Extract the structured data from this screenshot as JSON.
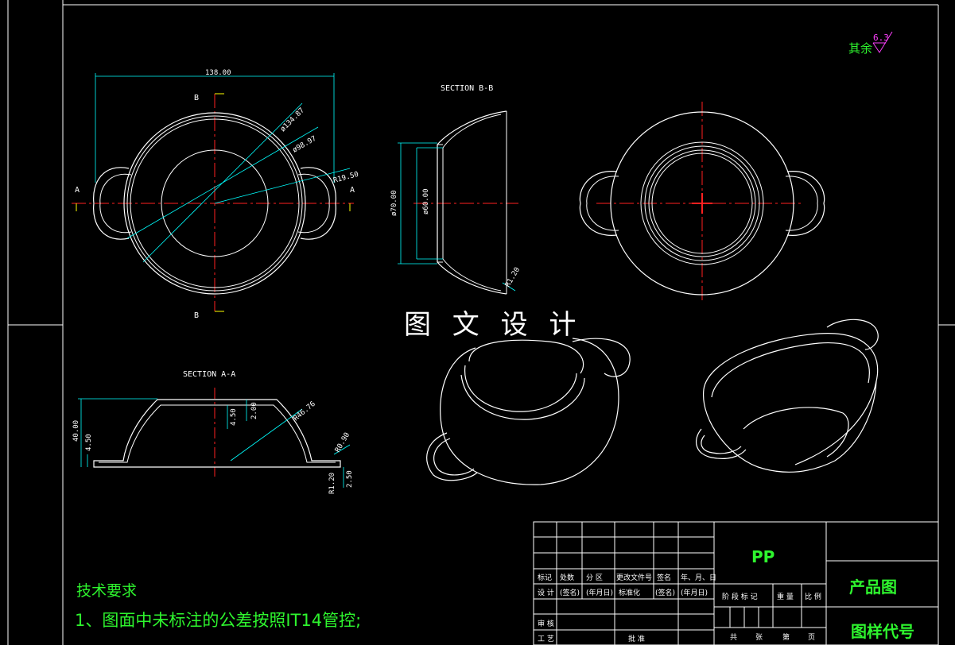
{
  "roughness": {
    "label": "其余",
    "value": "6.3"
  },
  "watermark": "图 文 设 计",
  "section_bb": "SECTION B-B",
  "section_aa": "SECTION A-A",
  "top_view": {
    "width_dim": "138.00",
    "dia1": "ø134.87",
    "dia2": "ø98.97",
    "r_dim": "R19.50",
    "label_a_left": "A",
    "label_a_right": "A",
    "label_b_top": "B",
    "label_b_bottom": "B"
  },
  "section_bb_dims": {
    "d_outer": "ø70.00",
    "d_inner": "ø60.00",
    "r": "R1.20"
  },
  "section_aa_dims": {
    "h_total": "40.00",
    "h_base": "4.50",
    "h_center": "4.50",
    "h_rim": "2.00",
    "r_big": "R46.76",
    "r_small": "R0.90",
    "r_foot": "R1.20",
    "thick": "2.50"
  },
  "tech": {
    "title": "技术要求",
    "line1": "1、图面中未标注的公差按照IT14管控;"
  },
  "title_block": {
    "material": "PP",
    "product": "产品图",
    "drawing_no": "图样代号",
    "row1": [
      "标记",
      "处数",
      "分 区",
      "更改文件号",
      "签名",
      "年、月、日"
    ],
    "row2": [
      "设 计",
      "(签名)",
      "(年月日)",
      "标准化",
      "(签名)",
      "(年月日)"
    ],
    "stage_headers": [
      "阶 段 标 记",
      "重 量",
      "比 例"
    ],
    "row_check": "审 核",
    "row_process": "工 艺",
    "row_approve": "批 准",
    "sheets": [
      "共",
      "张",
      "第",
      "页"
    ]
  },
  "colors": {
    "outline": "#ffffff",
    "dimension": "#00ffff",
    "centerline": "#ff2020",
    "accent_yellow": "#ffff00",
    "text_green": "#2ef52e",
    "magenta": "#ff40ff"
  }
}
